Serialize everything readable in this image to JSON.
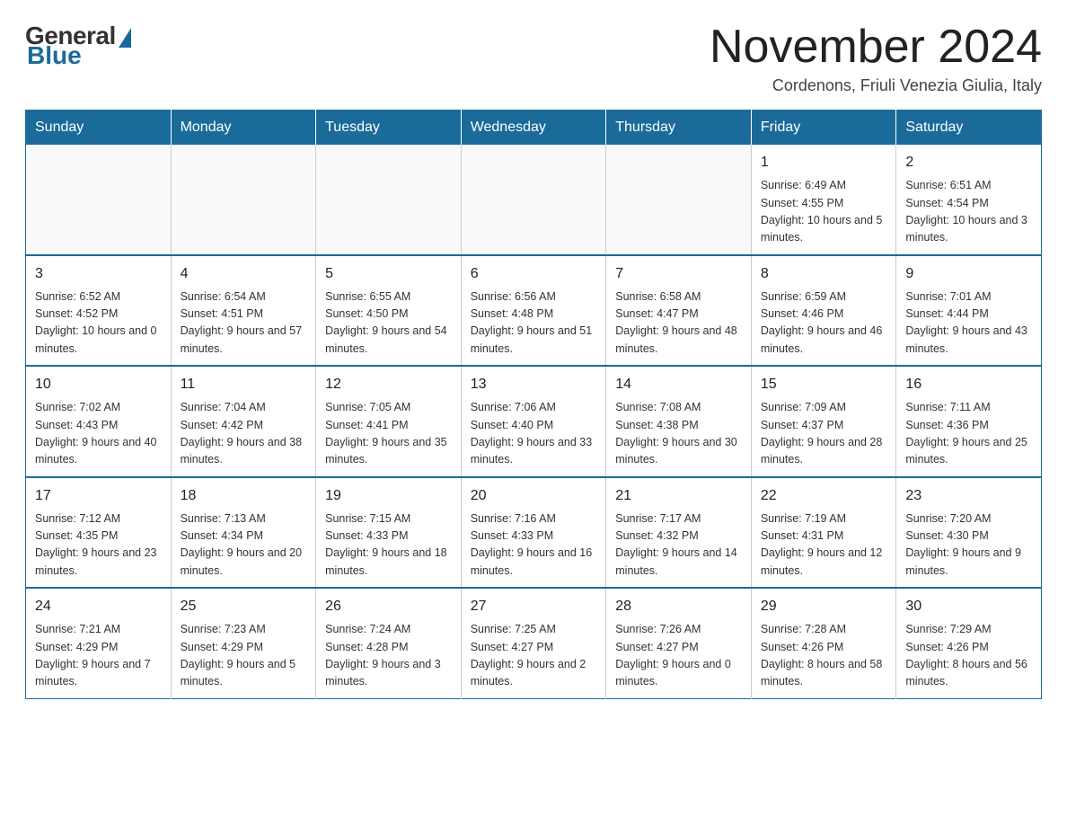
{
  "logo": {
    "general": "General",
    "blue": "Blue"
  },
  "header": {
    "month_year": "November 2024",
    "location": "Cordenons, Friuli Venezia Giulia, Italy"
  },
  "weekdays": [
    "Sunday",
    "Monday",
    "Tuesday",
    "Wednesday",
    "Thursday",
    "Friday",
    "Saturday"
  ],
  "weeks": [
    [
      {
        "day": "",
        "info": ""
      },
      {
        "day": "",
        "info": ""
      },
      {
        "day": "",
        "info": ""
      },
      {
        "day": "",
        "info": ""
      },
      {
        "day": "",
        "info": ""
      },
      {
        "day": "1",
        "info": "Sunrise: 6:49 AM\nSunset: 4:55 PM\nDaylight: 10 hours and 5 minutes."
      },
      {
        "day": "2",
        "info": "Sunrise: 6:51 AM\nSunset: 4:54 PM\nDaylight: 10 hours and 3 minutes."
      }
    ],
    [
      {
        "day": "3",
        "info": "Sunrise: 6:52 AM\nSunset: 4:52 PM\nDaylight: 10 hours and 0 minutes."
      },
      {
        "day": "4",
        "info": "Sunrise: 6:54 AM\nSunset: 4:51 PM\nDaylight: 9 hours and 57 minutes."
      },
      {
        "day": "5",
        "info": "Sunrise: 6:55 AM\nSunset: 4:50 PM\nDaylight: 9 hours and 54 minutes."
      },
      {
        "day": "6",
        "info": "Sunrise: 6:56 AM\nSunset: 4:48 PM\nDaylight: 9 hours and 51 minutes."
      },
      {
        "day": "7",
        "info": "Sunrise: 6:58 AM\nSunset: 4:47 PM\nDaylight: 9 hours and 48 minutes."
      },
      {
        "day": "8",
        "info": "Sunrise: 6:59 AM\nSunset: 4:46 PM\nDaylight: 9 hours and 46 minutes."
      },
      {
        "day": "9",
        "info": "Sunrise: 7:01 AM\nSunset: 4:44 PM\nDaylight: 9 hours and 43 minutes."
      }
    ],
    [
      {
        "day": "10",
        "info": "Sunrise: 7:02 AM\nSunset: 4:43 PM\nDaylight: 9 hours and 40 minutes."
      },
      {
        "day": "11",
        "info": "Sunrise: 7:04 AM\nSunset: 4:42 PM\nDaylight: 9 hours and 38 minutes."
      },
      {
        "day": "12",
        "info": "Sunrise: 7:05 AM\nSunset: 4:41 PM\nDaylight: 9 hours and 35 minutes."
      },
      {
        "day": "13",
        "info": "Sunrise: 7:06 AM\nSunset: 4:40 PM\nDaylight: 9 hours and 33 minutes."
      },
      {
        "day": "14",
        "info": "Sunrise: 7:08 AM\nSunset: 4:38 PM\nDaylight: 9 hours and 30 minutes."
      },
      {
        "day": "15",
        "info": "Sunrise: 7:09 AM\nSunset: 4:37 PM\nDaylight: 9 hours and 28 minutes."
      },
      {
        "day": "16",
        "info": "Sunrise: 7:11 AM\nSunset: 4:36 PM\nDaylight: 9 hours and 25 minutes."
      }
    ],
    [
      {
        "day": "17",
        "info": "Sunrise: 7:12 AM\nSunset: 4:35 PM\nDaylight: 9 hours and 23 minutes."
      },
      {
        "day": "18",
        "info": "Sunrise: 7:13 AM\nSunset: 4:34 PM\nDaylight: 9 hours and 20 minutes."
      },
      {
        "day": "19",
        "info": "Sunrise: 7:15 AM\nSunset: 4:33 PM\nDaylight: 9 hours and 18 minutes."
      },
      {
        "day": "20",
        "info": "Sunrise: 7:16 AM\nSunset: 4:33 PM\nDaylight: 9 hours and 16 minutes."
      },
      {
        "day": "21",
        "info": "Sunrise: 7:17 AM\nSunset: 4:32 PM\nDaylight: 9 hours and 14 minutes."
      },
      {
        "day": "22",
        "info": "Sunrise: 7:19 AM\nSunset: 4:31 PM\nDaylight: 9 hours and 12 minutes."
      },
      {
        "day": "23",
        "info": "Sunrise: 7:20 AM\nSunset: 4:30 PM\nDaylight: 9 hours and 9 minutes."
      }
    ],
    [
      {
        "day": "24",
        "info": "Sunrise: 7:21 AM\nSunset: 4:29 PM\nDaylight: 9 hours and 7 minutes."
      },
      {
        "day": "25",
        "info": "Sunrise: 7:23 AM\nSunset: 4:29 PM\nDaylight: 9 hours and 5 minutes."
      },
      {
        "day": "26",
        "info": "Sunrise: 7:24 AM\nSunset: 4:28 PM\nDaylight: 9 hours and 3 minutes."
      },
      {
        "day": "27",
        "info": "Sunrise: 7:25 AM\nSunset: 4:27 PM\nDaylight: 9 hours and 2 minutes."
      },
      {
        "day": "28",
        "info": "Sunrise: 7:26 AM\nSunset: 4:27 PM\nDaylight: 9 hours and 0 minutes."
      },
      {
        "day": "29",
        "info": "Sunrise: 7:28 AM\nSunset: 4:26 PM\nDaylight: 8 hours and 58 minutes."
      },
      {
        "day": "30",
        "info": "Sunrise: 7:29 AM\nSunset: 4:26 PM\nDaylight: 8 hours and 56 minutes."
      }
    ]
  ]
}
